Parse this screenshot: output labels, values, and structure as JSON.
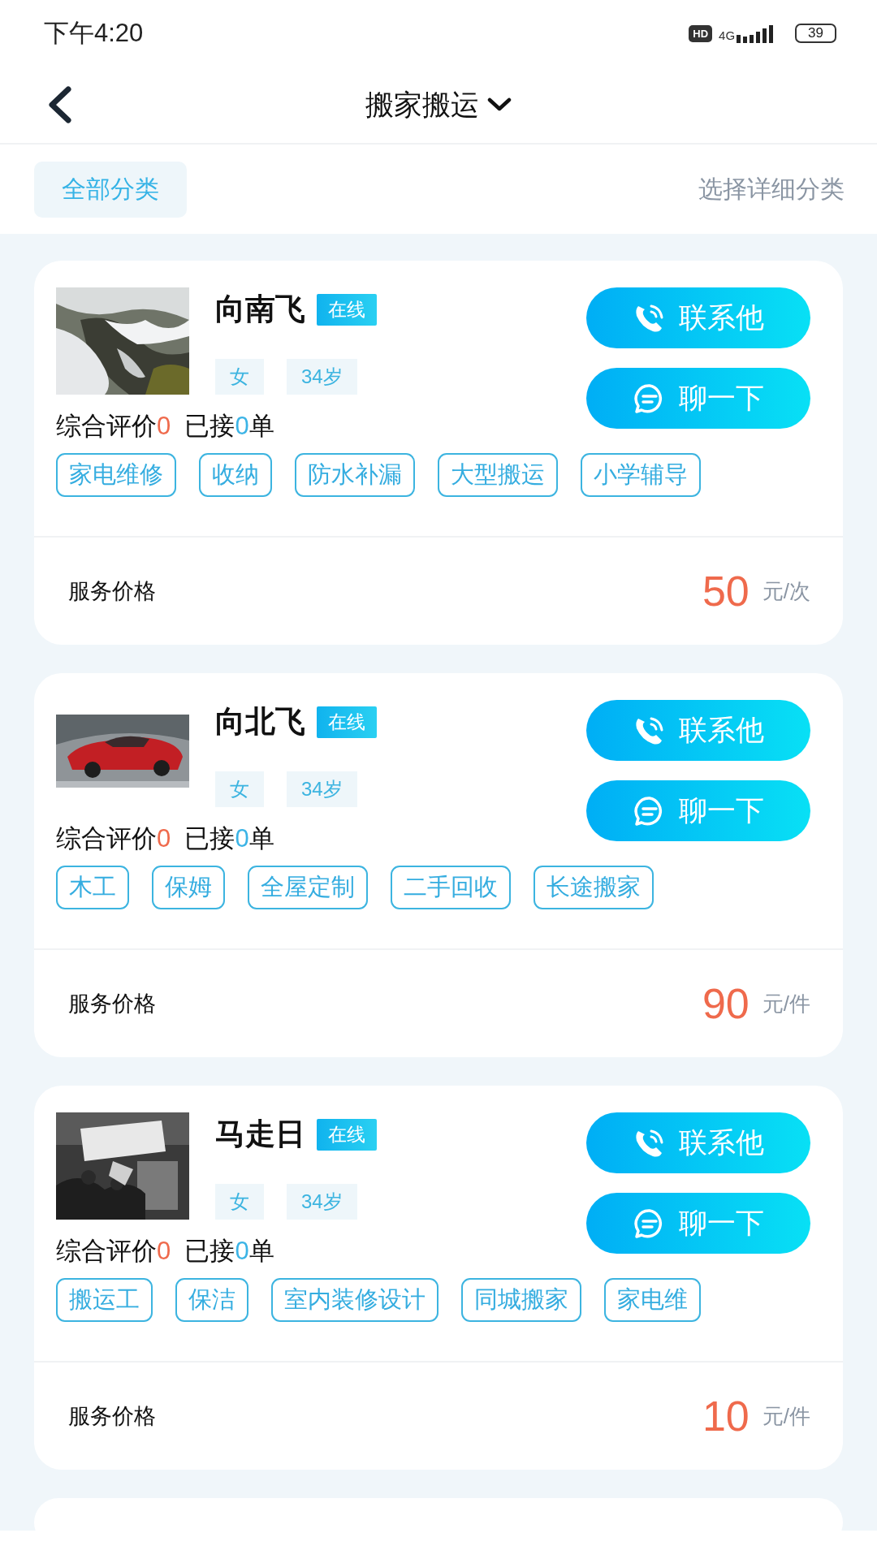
{
  "status_bar": {
    "time": "下午4:20",
    "hd": "HD",
    "network": "4G",
    "battery": "39"
  },
  "header": {
    "title": "搬家搬运"
  },
  "filter": {
    "all_label": "全部分类",
    "detail_label": "选择详细分类"
  },
  "providers": [
    {
      "name": "向南飞",
      "status": "在线",
      "gender": "女",
      "age": "34岁",
      "rating_label": "综合评价",
      "rating": "0",
      "orders_label": "已接",
      "orders": "0",
      "orders_unit": "单",
      "call_label": "联系他",
      "chat_label": "聊一下",
      "tags": [
        "家电维修",
        "收纳",
        "防水补漏",
        "大型搬运",
        "小学辅导"
      ],
      "price_label": "服务价格",
      "price": "50",
      "price_unit": "元/次"
    },
    {
      "name": "向北飞",
      "status": "在线",
      "gender": "女",
      "age": "34岁",
      "rating_label": "综合评价",
      "rating": "0",
      "orders_label": "已接",
      "orders": "0",
      "orders_unit": "单",
      "call_label": "联系他",
      "chat_label": "聊一下",
      "tags": [
        "木工",
        "保姆",
        "全屋定制",
        "二手回收",
        "长途搬家"
      ],
      "price_label": "服务价格",
      "price": "90",
      "price_unit": "元/件"
    },
    {
      "name": "马走日",
      "status": "在线",
      "gender": "女",
      "age": "34岁",
      "rating_label": "综合评价",
      "rating": "0",
      "orders_label": "已接",
      "orders": "0",
      "orders_unit": "单",
      "call_label": "联系他",
      "chat_label": "聊一下",
      "tags": [
        "搬运工",
        "保洁",
        "室内装修设计",
        "同城搬家",
        "家电维"
      ],
      "price_label": "服务价格",
      "price": "10",
      "price_unit": "元/件"
    }
  ]
}
